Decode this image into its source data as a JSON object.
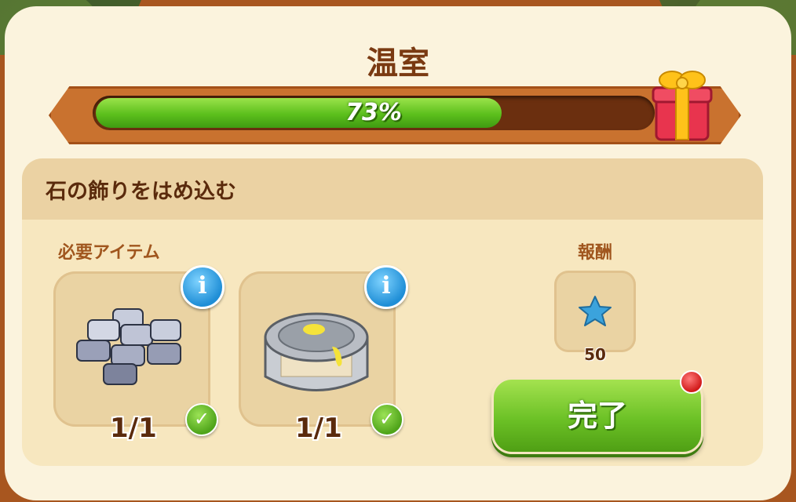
{
  "window": {
    "title": "温室"
  },
  "progress": {
    "percent": 73,
    "label": "73%"
  },
  "task": {
    "title": "石の飾りをはめ込む"
  },
  "required_items": {
    "label": "必要アイテム",
    "items": [
      {
        "icon": "stone-tiles-icon",
        "count_label": "1/1",
        "complete": true
      },
      {
        "icon": "paint-can-icon",
        "count_label": "1/1",
        "complete": true
      }
    ]
  },
  "reward": {
    "label": "報酬",
    "icon": "blue-star-icon",
    "amount": "50"
  },
  "complete_button": {
    "label": "完了"
  },
  "colors": {
    "frame": "#a8561f",
    "panel": "#fbf3dd",
    "progress_fill": "#5cbf1c",
    "button": "#6cc126",
    "title": "#7a3a12"
  }
}
